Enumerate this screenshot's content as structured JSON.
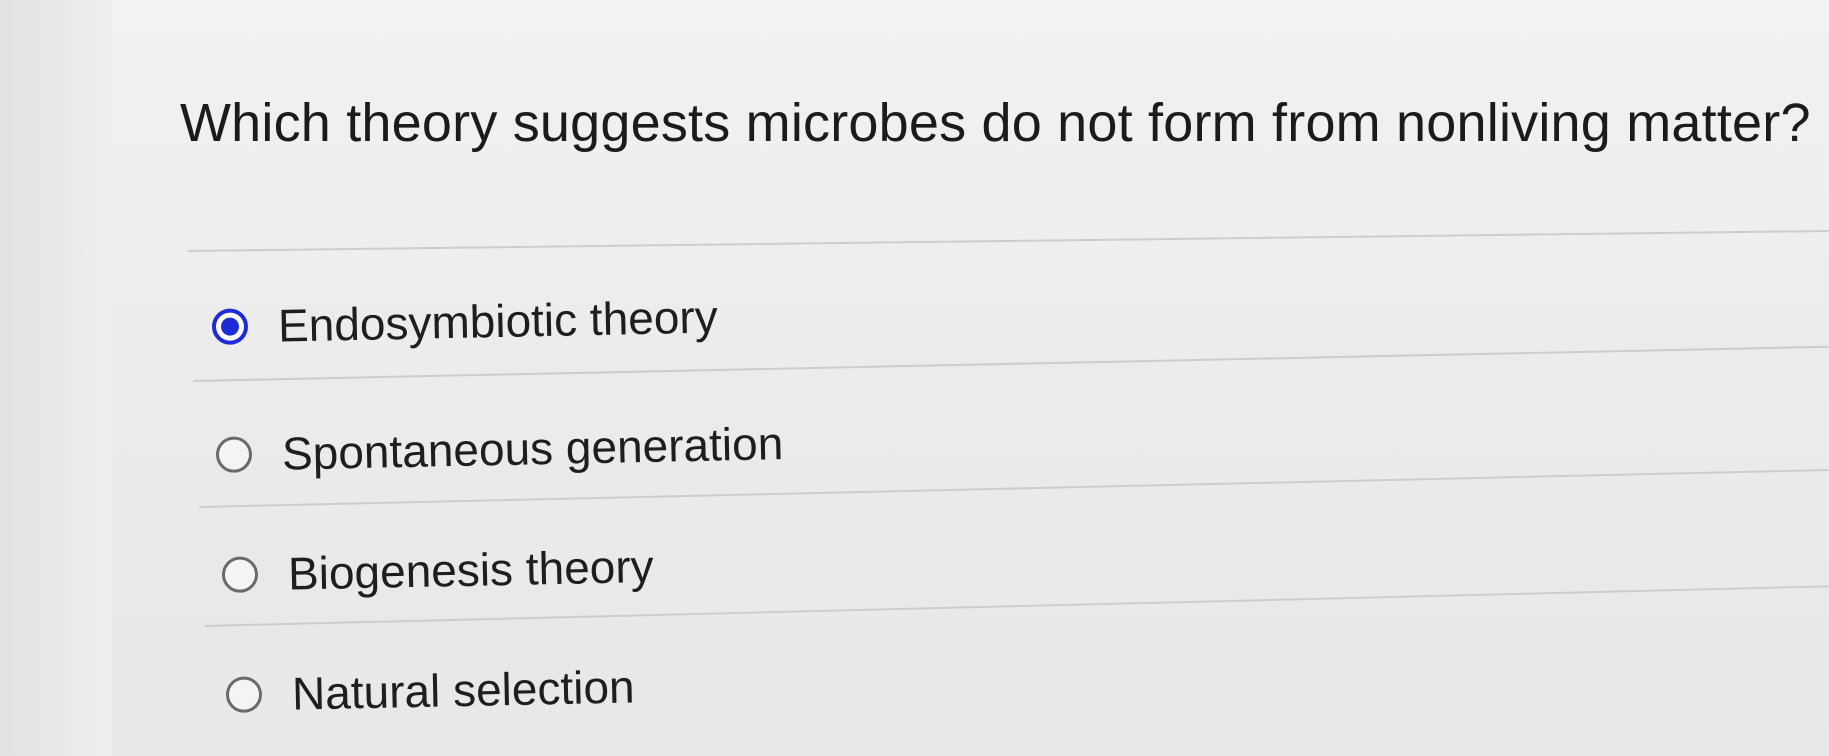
{
  "question": {
    "text": "Which theory suggests microbes do not form from nonliving matter?"
  },
  "options": [
    {
      "label": "Endosymbiotic theory",
      "selected": true
    },
    {
      "label": "Spontaneous generation",
      "selected": false
    },
    {
      "label": "Biogenesis theory",
      "selected": false
    },
    {
      "label": "Natural selection",
      "selected": false
    }
  ],
  "colors": {
    "selected_radio": "#1d2bd8",
    "text": "#1e1e1e",
    "background": "#ececec"
  }
}
